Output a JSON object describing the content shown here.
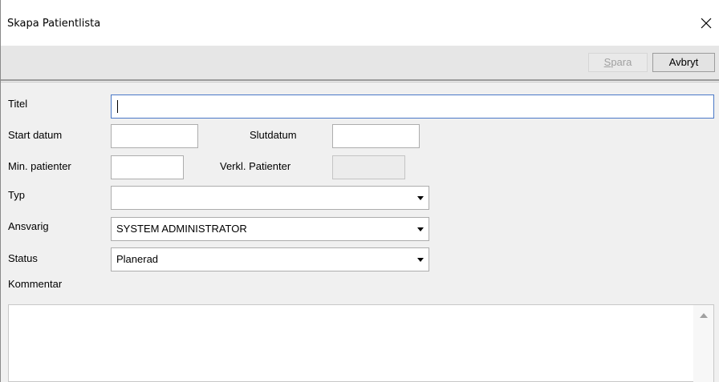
{
  "window": {
    "title": "Skapa Patientlista",
    "close_icon": "close-icon"
  },
  "toolbar": {
    "save_mnemonic": "S",
    "save_rest": "para",
    "cancel_label": "Avbryt"
  },
  "form": {
    "title_label": "Titel",
    "title_value": "",
    "start_date_label": "Start datum",
    "start_date_value": "",
    "end_date_label": "Slutdatum",
    "end_date_value": "",
    "min_patients_label": "Min. patienter",
    "min_patients_value": "",
    "actual_patients_label": "Verkl. Patienter",
    "actual_patients_value": "",
    "type_label": "Typ",
    "type_value": "",
    "responsible_label": "Ansvarig",
    "responsible_value": "SYSTEM ADMINISTRATOR",
    "status_label": "Status",
    "status_value": "Planerad",
    "comment_label": "Kommentar",
    "comment_value": ""
  },
  "colors": {
    "focus_border": "#4a78c7",
    "background": "#f0f0f0"
  }
}
